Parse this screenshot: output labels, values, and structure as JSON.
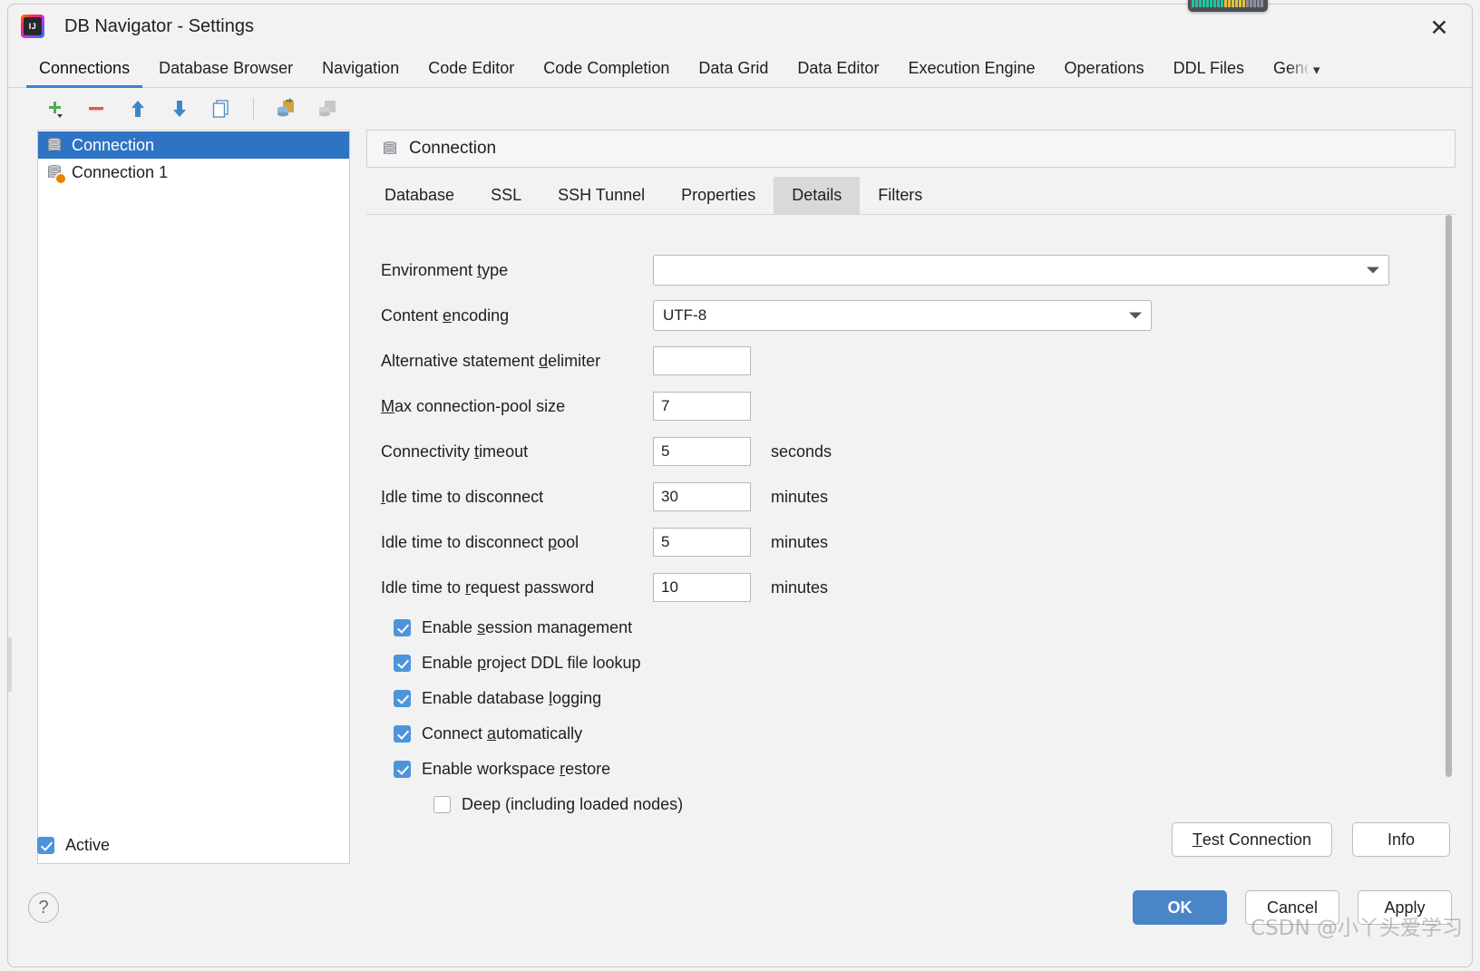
{
  "window": {
    "title": "DB Navigator - Settings",
    "app_icon": "intellij-idea-icon",
    "close_icon": "close-icon"
  },
  "tabs": [
    {
      "label": "Connections",
      "active": true
    },
    {
      "label": "Database Browser",
      "active": false
    },
    {
      "label": "Navigation",
      "active": false
    },
    {
      "label": "Code Editor",
      "active": false
    },
    {
      "label": "Code Completion",
      "active": false
    },
    {
      "label": "Data Grid",
      "active": false
    },
    {
      "label": "Data Editor",
      "active": false
    },
    {
      "label": "Execution Engine",
      "active": false
    },
    {
      "label": "Operations",
      "active": false
    },
    {
      "label": "DDL Files",
      "active": false
    },
    {
      "label": "Gene",
      "active": false,
      "clipped": true
    }
  ],
  "tabs_overflow_icon": "chevron-down-icon",
  "toolbar": [
    {
      "name": "add-connection-button",
      "icon": "plus-icon"
    },
    {
      "name": "remove-connection-button",
      "icon": "minus-icon"
    },
    {
      "name": "move-up-button",
      "icon": "arrow-up-icon"
    },
    {
      "name": "move-down-button",
      "icon": "arrow-down-icon"
    },
    {
      "name": "duplicate-connection-button",
      "icon": "copy-pages-icon"
    },
    {
      "name": "import-connection-button",
      "icon": "import-database-icon"
    },
    {
      "name": "export-connection-button",
      "icon": "export-database-icon"
    }
  ],
  "connection_list": [
    {
      "label": "Connection",
      "selected": true,
      "icon": "database-icon"
    },
    {
      "label": "Connection 1",
      "selected": false,
      "icon": "database-configured-icon"
    }
  ],
  "detail": {
    "header": "Connection",
    "header_icon": "database-icon",
    "subtabs": [
      {
        "label": "Database",
        "active": false
      },
      {
        "label": "SSL",
        "active": false
      },
      {
        "label": "SSH Tunnel",
        "active": false
      },
      {
        "label": "Properties",
        "active": false
      },
      {
        "label": "Details",
        "active": true
      },
      {
        "label": "Filters",
        "active": false
      }
    ],
    "fields": [
      {
        "label_pre": "Environment ",
        "mnemonic": "t",
        "label_post": "ype",
        "value": "",
        "unit": "",
        "control": "combo-wide"
      },
      {
        "label_pre": "Content ",
        "mnemonic": "e",
        "label_post": "ncoding",
        "value": "UTF-8",
        "unit": "",
        "control": "combo-mid"
      },
      {
        "label_pre": "Alternative statement ",
        "mnemonic": "d",
        "label_post": "elimiter",
        "value": "",
        "unit": "",
        "control": "text"
      },
      {
        "label_pre": "",
        "mnemonic": "M",
        "label_post": "ax connection-pool size",
        "value": "7",
        "unit": "",
        "control": "text"
      },
      {
        "label_pre": "Connectivity ",
        "mnemonic": "t",
        "label_post": "imeout",
        "value": "5",
        "unit": "seconds",
        "control": "text"
      },
      {
        "label_pre": "",
        "mnemonic": "I",
        "label_post": "dle time to disconnect",
        "value": "30",
        "unit": "minutes",
        "control": "text"
      },
      {
        "label_pre": "Idle time to disconnect ",
        "mnemonic": "p",
        "label_post": "ool",
        "value": "5",
        "unit": "minutes",
        "control": "text"
      },
      {
        "label_pre": "Idle time to ",
        "mnemonic": "r",
        "label_post": "equest password",
        "value": "10",
        "unit": "minutes",
        "control": "text"
      }
    ],
    "checkboxes": [
      {
        "label_pre": "Enable ",
        "mnemonic": "s",
        "label_post": "ession management",
        "checked": true,
        "indent": false
      },
      {
        "label_pre": "Enable ",
        "mnemonic": "p",
        "label_post": "roject DDL file lookup",
        "checked": true,
        "indent": false
      },
      {
        "label_pre": "Enable database ",
        "mnemonic": "l",
        "label_post": "ogging",
        "checked": true,
        "indent": false
      },
      {
        "label_pre": "Connect ",
        "mnemonic": "a",
        "label_post": "utomatically",
        "checked": true,
        "indent": false
      },
      {
        "label_pre": "Enable workspace ",
        "mnemonic": "r",
        "label_post": "estore",
        "checked": true,
        "indent": false
      },
      {
        "label_pre": "Deep (including loaded nodes)",
        "mnemonic": "",
        "label_post": "",
        "checked": false,
        "indent": true
      }
    ]
  },
  "active_checkbox": {
    "label": "Active",
    "checked": true
  },
  "actions": {
    "test_connection_pre": "",
    "test_connection_mnemonic": "T",
    "test_connection_post": "est Connection",
    "info": "Info"
  },
  "footer": {
    "help_icon": "question-mark-icon",
    "ok": "OK",
    "cancel": "Cancel",
    "apply": "Apply"
  },
  "watermark": "CSDN @小丫头爱学习",
  "colors": {
    "accent": "#3d7fd0",
    "selection": "#2f74c4",
    "primary_button": "#4a86c7",
    "checkbox_on": "#4d94da",
    "window_bg": "#f2f2f2"
  }
}
